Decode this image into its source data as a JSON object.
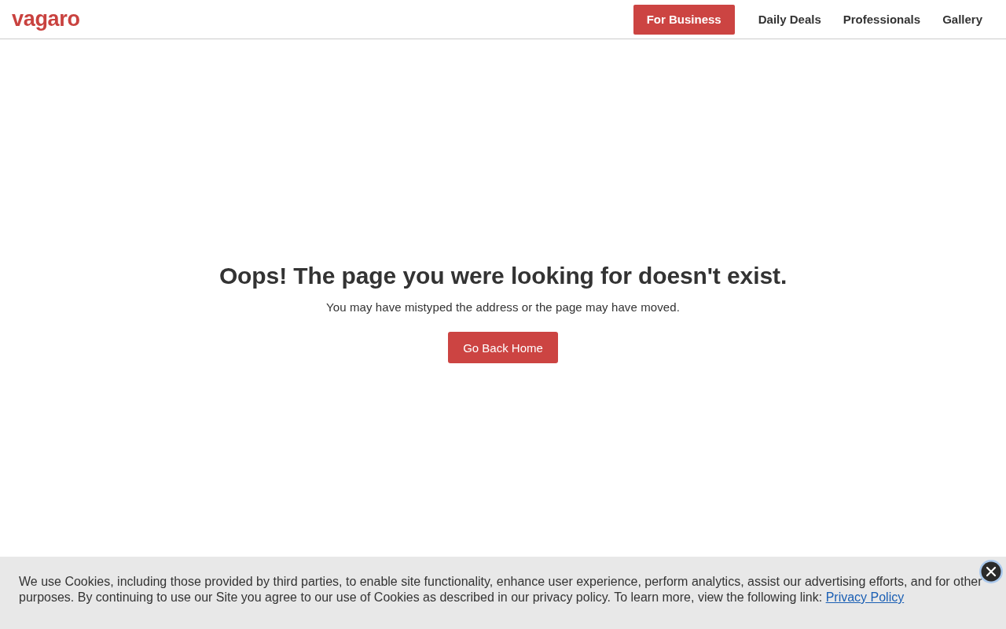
{
  "header": {
    "logo": "vagaro",
    "nav": [
      {
        "label": "For Business",
        "kind": "primary"
      },
      {
        "label": "Daily Deals",
        "kind": "link"
      },
      {
        "label": "Professionals",
        "kind": "link"
      },
      {
        "label": "Gallery",
        "kind": "link"
      }
    ]
  },
  "error": {
    "title": "Oops! The page you were looking for doesn't exist.",
    "message": "You may have mistyped the address or the page may have moved.",
    "button": "Go Back Home"
  },
  "cookie_banner": {
    "text": "We use Cookies, including those provided by third parties, to enable site functionality, enhance user experience, perform analytics, assist our advertising efforts, and for other purposes. By continuing to use our Site you agree to our use of Cookies as described in our privacy policy. To learn more, view the following link:",
    "link": "Privacy Policy"
  }
}
